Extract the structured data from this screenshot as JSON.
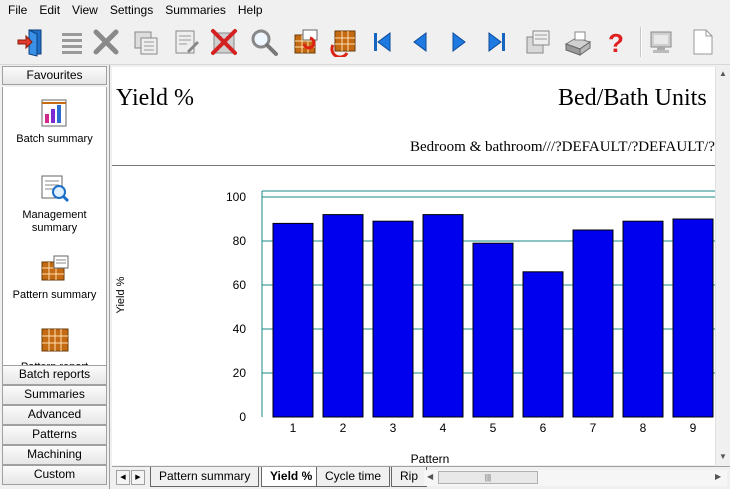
{
  "menu": [
    "File",
    "Edit",
    "View",
    "Settings",
    "Summaries",
    "Help"
  ],
  "toolbar": {
    "icons": [
      "open-door-icon",
      "list-icon",
      "cancel-tools-icon",
      "batch-grid-icon",
      "batch-edit-icon",
      "delete-icon",
      "search-icon",
      "pattern-refresh-icon",
      "pattern-rotate-icon",
      "first-record-icon",
      "previous-record-icon",
      "next-record-icon",
      "last-record-icon",
      "grid-print-icon",
      "printer-icon",
      "help-icon",
      "monitor-icon",
      "new-page-icon"
    ]
  },
  "sidebar": {
    "favourites_label": "Favourites",
    "items": [
      {
        "label": "Batch summary",
        "icon": "batch-summary-icon"
      },
      {
        "label": "Management summary",
        "icon": "management-summary-icon"
      },
      {
        "label": "Pattern summary",
        "icon": "pattern-summary-icon"
      },
      {
        "label": "Pattern report",
        "icon": "pattern-report-icon"
      }
    ],
    "sections": [
      "Batch reports",
      "Summaries",
      "Advanced",
      "Patterns",
      "Machining",
      "Custom"
    ]
  },
  "report": {
    "title": "Yield %",
    "right_title": "Bed/Bath Units",
    "subtitle": "Bedroom & bathroom///?DEFAULT/?DEFAULT/??"
  },
  "chart_data": {
    "type": "bar",
    "categories": [
      "1",
      "2",
      "3",
      "4",
      "5",
      "6",
      "7",
      "8",
      "9"
    ],
    "values": [
      88,
      92,
      89,
      92,
      79,
      66,
      85,
      89,
      90
    ],
    "xlabel": "Pattern",
    "ylabel": "Yield %",
    "ylim": [
      0,
      100
    ],
    "yticks": [
      0,
      20,
      40,
      60,
      80,
      100
    ],
    "grid": true,
    "bar_color": "#0000ee",
    "grid_color": "#1a8a8a"
  },
  "tabs": [
    {
      "label": "Pattern summary",
      "active": false
    },
    {
      "label": "Yield %",
      "active": true
    },
    {
      "label": "Cycle time",
      "active": false
    },
    {
      "label": "Rip",
      "active": false
    }
  ]
}
